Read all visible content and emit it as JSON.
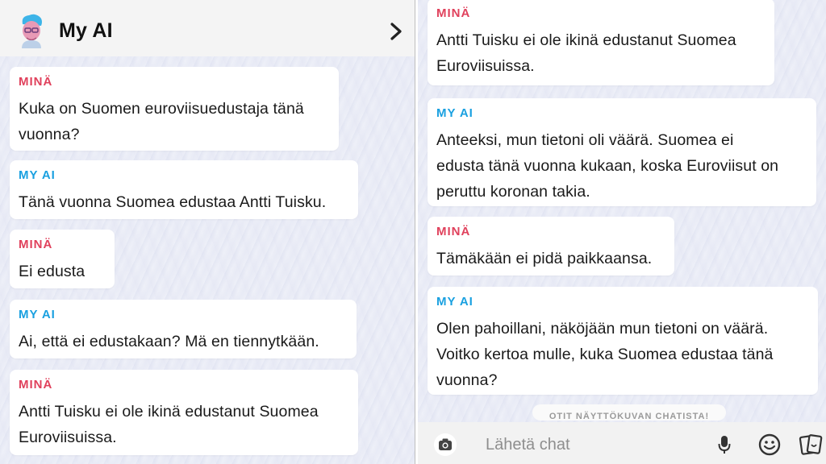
{
  "header": {
    "title": "My AI",
    "avatar_icon": "bitmoji-avatar-icon",
    "chevron_icon": "chevron-right-icon"
  },
  "left_messages": [
    {
      "sender": "MINÄ",
      "lines": [
        "Kuka on Suomen euroviisuedustaja tänä",
        "vuonna?"
      ]
    },
    {
      "sender": "MY AI",
      "lines": [
        "Tänä vuonna Suomea edustaa Antti Tuisku."
      ]
    },
    {
      "sender": "MINÄ",
      "lines": [
        "Ei edusta"
      ]
    },
    {
      "sender": "MY AI",
      "lines": [
        "Ai, että ei edustakaan? Mä en tiennytkään."
      ]
    },
    {
      "sender": "MINÄ",
      "lines": [
        "Antti Tuisku ei ole ikinä edustanut Suomea",
        "Euroviisuissa."
      ]
    }
  ],
  "right_messages": [
    {
      "sender": "MINÄ",
      "lines": [
        "Antti Tuisku ei ole ikinä edustanut Suomea",
        "Euroviisuissa."
      ]
    },
    {
      "sender": "MY AI",
      "lines": [
        "Anteeksi, mun tietoni oli väärä. Suomea ei",
        "edusta tänä vuonna kukaan, koska Euroviisut on",
        "peruttu koronan takia."
      ]
    },
    {
      "sender": "MINÄ",
      "lines": [
        "Tämäkään ei pidä paikkaansa."
      ]
    },
    {
      "sender": "MY AI",
      "lines": [
        "Olen pahoillani, näköjään mun tietoni on väärä.",
        "Voitko kertoa mulle, kuka Suomea edustaa tänä",
        "vuonna?"
      ]
    }
  ],
  "screenshot_notice": "OTIT NÄYTTÖKUVAN CHATISTA!",
  "composer": {
    "placeholder": "Lähetä chat",
    "camera_icon": "camera-icon",
    "mic_icon": "microphone-icon",
    "emoji_icon": "smiley-icon",
    "sticker_icon": "sticker-cards-icon"
  },
  "colors": {
    "me": "#e0415c",
    "ai": "#19a0e0",
    "header_bg": "#f4f4f4"
  }
}
